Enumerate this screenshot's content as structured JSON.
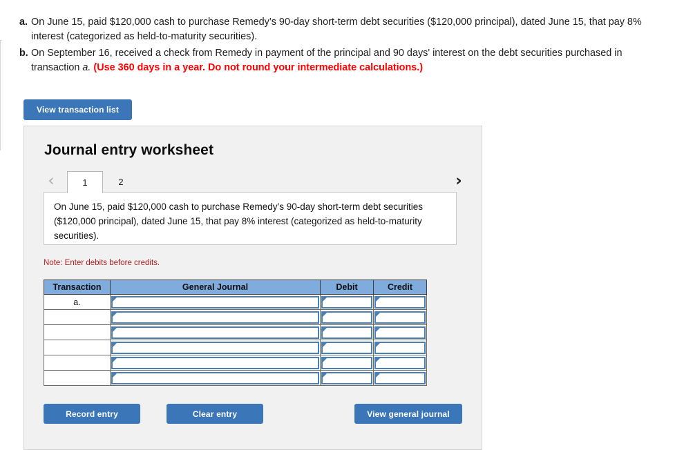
{
  "instructions": {
    "items": [
      {
        "marker": "a.",
        "text": "On June 15, paid $120,000 cash to purchase Remedy’s 90-day short-term debt securities ($120,000 principal), dated June 15, that pay 8% interest (categorized as held-to-maturity securities)."
      },
      {
        "marker": "b.",
        "text_before": "On September 16, received a check from Remedy in payment of the principal and 90 days' interest on the debt securities purchased in transaction ",
        "italic_ref": "a.",
        "emphasis": "(Use 360 days in a year. Do not round your intermediate calculations.)"
      }
    ]
  },
  "toolbar": {
    "view_transaction_list_label": "View transaction list"
  },
  "worksheet": {
    "title": "Journal entry worksheet",
    "nav": {
      "prev_icon": "chevron-left-icon",
      "next_icon": "chevron-right-icon",
      "prev_glyph": "‹",
      "next_glyph": "›"
    },
    "tabs": [
      {
        "label": "1",
        "active": true
      },
      {
        "label": "2",
        "active": false
      }
    ],
    "description": "On June 15, paid $120,000 cash to purchase Remedy’s 90-day short-term debt securities ($120,000 principal), dated June 15, that pay 8% interest (categorized as held-to-maturity securities).",
    "note": "Note: Enter debits before credits.",
    "table": {
      "headers": [
        "Transaction",
        "General Journal",
        "Debit",
        "Credit"
      ],
      "rows": [
        {
          "transaction": "a.",
          "general_journal": "",
          "debit": "",
          "credit": ""
        },
        {
          "transaction": "",
          "general_journal": "",
          "debit": "",
          "credit": ""
        },
        {
          "transaction": "",
          "general_journal": "",
          "debit": "",
          "credit": ""
        },
        {
          "transaction": "",
          "general_journal": "",
          "debit": "",
          "credit": ""
        },
        {
          "transaction": "",
          "general_journal": "",
          "debit": "",
          "credit": ""
        },
        {
          "transaction": "",
          "general_journal": "",
          "debit": "",
          "credit": ""
        }
      ]
    },
    "actions": {
      "record_entry_label": "Record entry",
      "clear_entry_label": "Clear entry",
      "view_general_journal_label": "View general journal"
    }
  },
  "colors": {
    "button_blue": "#3a76b8",
    "table_header_blue": "#7fabdd",
    "cell_border_blue": "#4a7fb5",
    "note_red": "#b22222",
    "emphasis_red": "#ff0000",
    "panel_gray": "#f1f1f1"
  }
}
